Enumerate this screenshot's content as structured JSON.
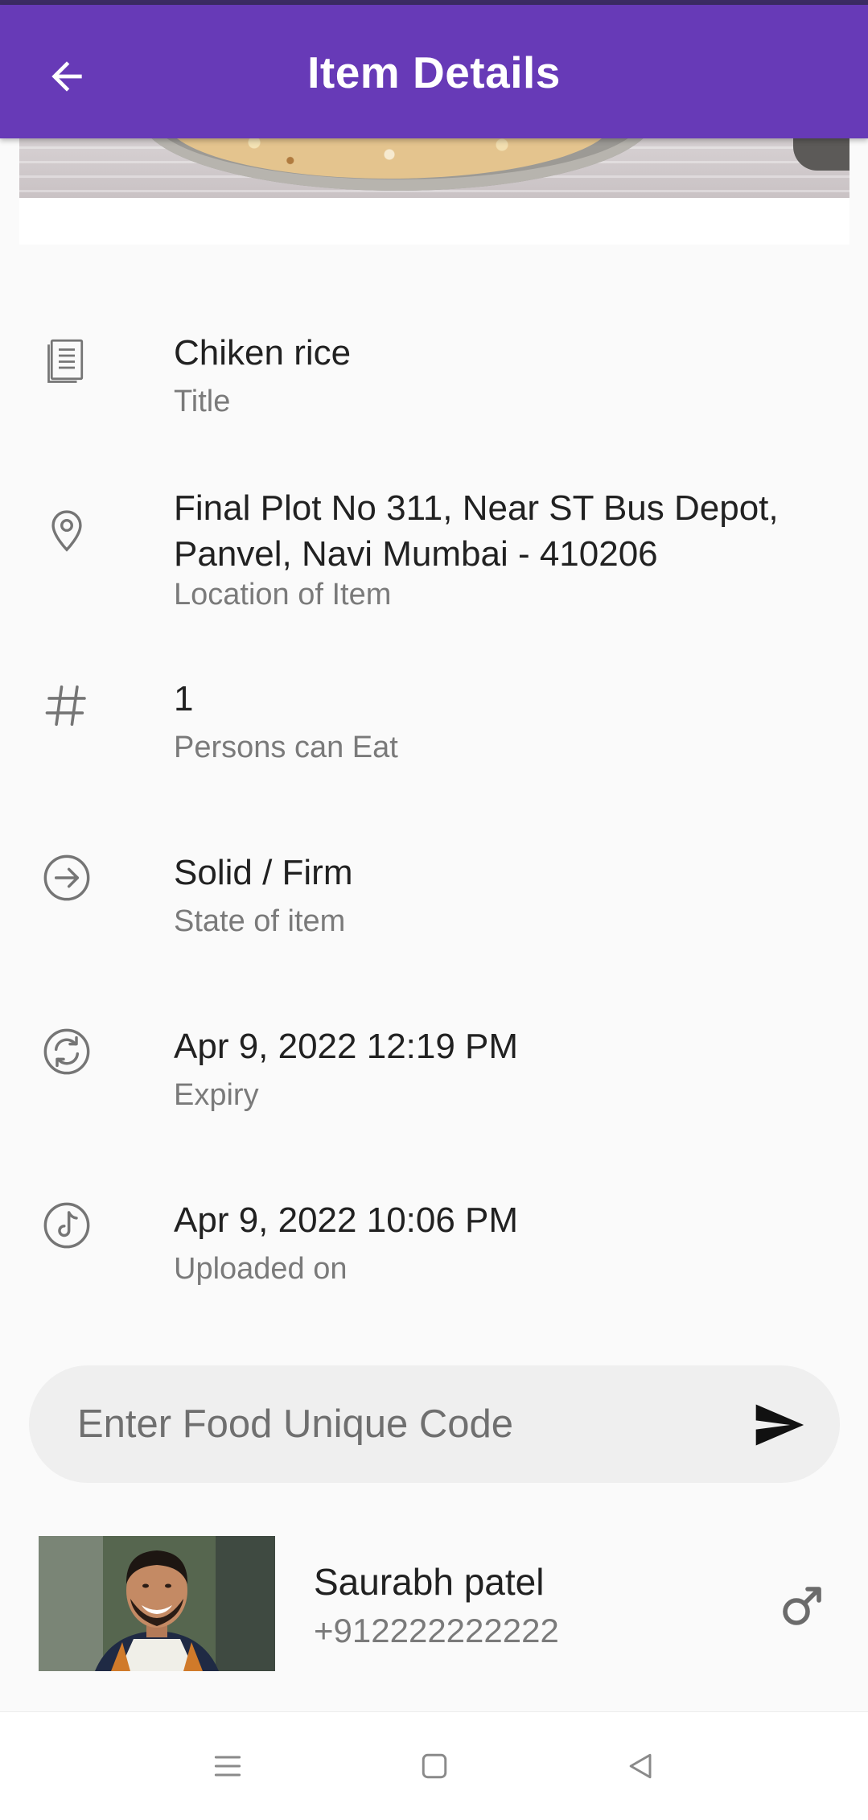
{
  "appbar": {
    "title": "Item Details",
    "background": "#673ab7",
    "back_icon": "arrow-left-icon"
  },
  "details": [
    {
      "icon": "document-icon",
      "value": "Chiken rice",
      "label": "Title"
    },
    {
      "icon": "location-pin-icon",
      "value": "Final Plot No 311, Near ST Bus Depot, Panvel, Navi Mumbai - 410206",
      "label": "Location of Item"
    },
    {
      "icon": "hash-icon",
      "value": "1",
      "label": "Persons can Eat"
    },
    {
      "icon": "arrow-circle-right-icon",
      "value": "Solid / Firm",
      "label": "State of item"
    },
    {
      "icon": "refresh-circle-icon",
      "value": "Apr 9, 2022 12:19 PM",
      "label": "Expiry"
    },
    {
      "icon": "upload-circle-icon",
      "value": "Apr 9, 2022 10:06 PM",
      "label": "Uploaded on"
    }
  ],
  "code_entry": {
    "placeholder": "Enter Food Unique Code",
    "value": "",
    "send_icon": "send-icon"
  },
  "user": {
    "name": "Saurabh patel",
    "phone": "+912222222222",
    "gender_icon": "male-icon"
  },
  "navbar": {
    "icons": [
      "menu-icon",
      "home-square-icon",
      "back-triangle-icon"
    ]
  }
}
